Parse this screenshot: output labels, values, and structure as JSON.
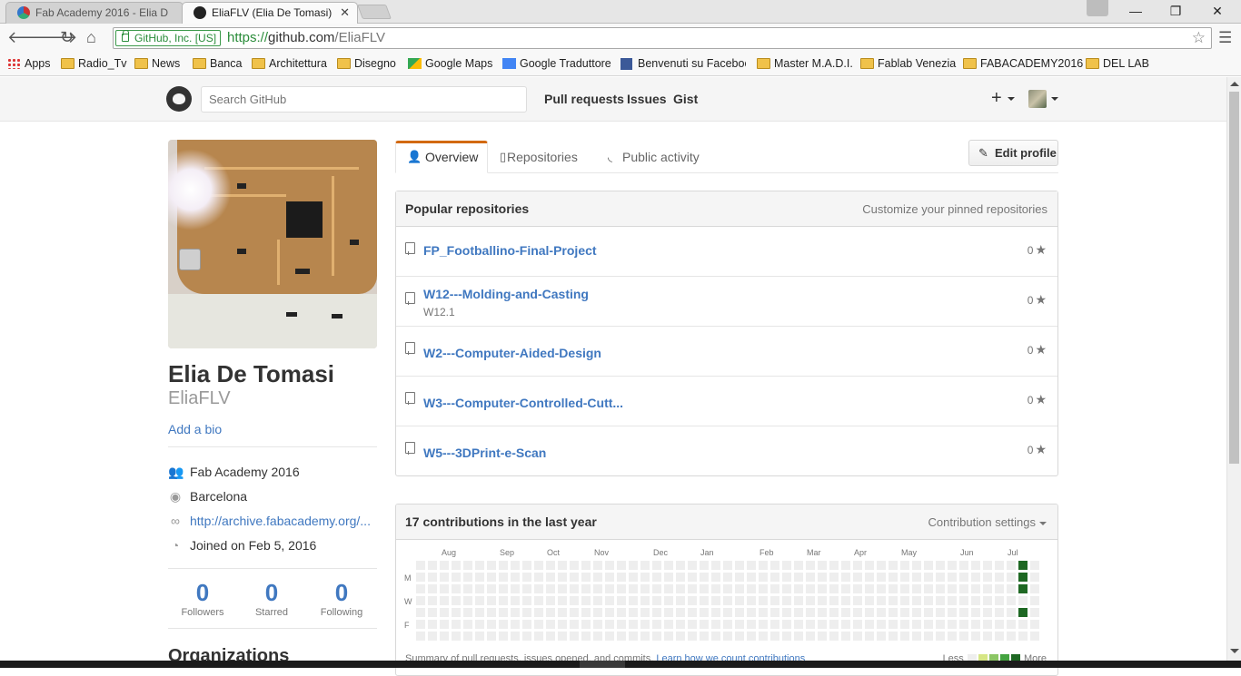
{
  "browser": {
    "tabs": [
      {
        "title": "Fab Academy 2016 - Elia D",
        "active": false
      },
      {
        "title": "EliaFLV (Elia De Tomasi)",
        "active": true
      }
    ],
    "ev_label": "GitHub, Inc. [US]",
    "url_scheme": "https://",
    "url_host": "github.com",
    "url_path": "/EliaFLV",
    "bookmarks": [
      "Apps",
      "Radio_Tv",
      "News",
      "Banca",
      "Architettura",
      "Disegno",
      "Google Maps",
      "Google Traduttore",
      "Benvenuti su Faceboo",
      "Master M.A.D.I.",
      "Fablab Venezia",
      "FABACADEMY2016",
      "DEL LAB"
    ]
  },
  "github_header": {
    "search_placeholder": "Search GitHub",
    "nav": [
      "Pull requests",
      "Issues",
      "Gist"
    ],
    "plus_label": "+"
  },
  "profile": {
    "full_name": "Elia De Tomasi",
    "username": "EliaFLV",
    "add_bio": "Add a bio",
    "organization": "Fab Academy 2016",
    "location": "Barcelona",
    "website": "http://archive.fabacademy.org/...",
    "joined": "Joined on Feb 5, 2016",
    "stats": [
      {
        "count": "0",
        "label": "Followers"
      },
      {
        "count": "0",
        "label": "Starred"
      },
      {
        "count": "0",
        "label": "Following"
      }
    ],
    "organizations_heading": "Organizations"
  },
  "profile_tabs": {
    "overview": "Overview",
    "repositories": "Repositories",
    "public_activity": "Public activity",
    "edit_profile": "Edit profile"
  },
  "popular_repos": {
    "title": "Popular repositories",
    "customize_link": "Customize your pinned repositories",
    "items": [
      {
        "name": "FP_Footballino-Final-Project",
        "description": "",
        "stars": "0"
      },
      {
        "name": "W12---Molding-and-Casting",
        "description": "W12.1",
        "stars": "0"
      },
      {
        "name": "W2---Computer-Aided-Design",
        "description": "",
        "stars": "0"
      },
      {
        "name": "W3---Computer-Controlled-Cutt...",
        "description": "",
        "stars": "0"
      },
      {
        "name": "W5---3DPrint-e-Scan",
        "description": "",
        "stars": "0"
      }
    ]
  },
  "contributions": {
    "title": "17 contributions in the last year",
    "settings_label": "Contribution settings",
    "months": [
      "Aug",
      "Sep",
      "Oct",
      "Nov",
      "Dec",
      "Jan",
      "Feb",
      "Mar",
      "Apr",
      "May",
      "Jun",
      "Jul"
    ],
    "weekday_labels": [
      "M",
      "W",
      "F"
    ],
    "summary_text": "Summary of pull requests, issues opened, and commits.",
    "summary_link": "Learn how we count contributions",
    "legend_less": "Less",
    "legend_more": "More",
    "colors": {
      "empty": "#eeeeee",
      "level1": "#d6e685",
      "level2": "#8cc665",
      "level3": "#44a340",
      "level4": "#1e6823"
    }
  },
  "theme": {
    "link": "#4078c0",
    "tab_accent": "#d26911"
  }
}
